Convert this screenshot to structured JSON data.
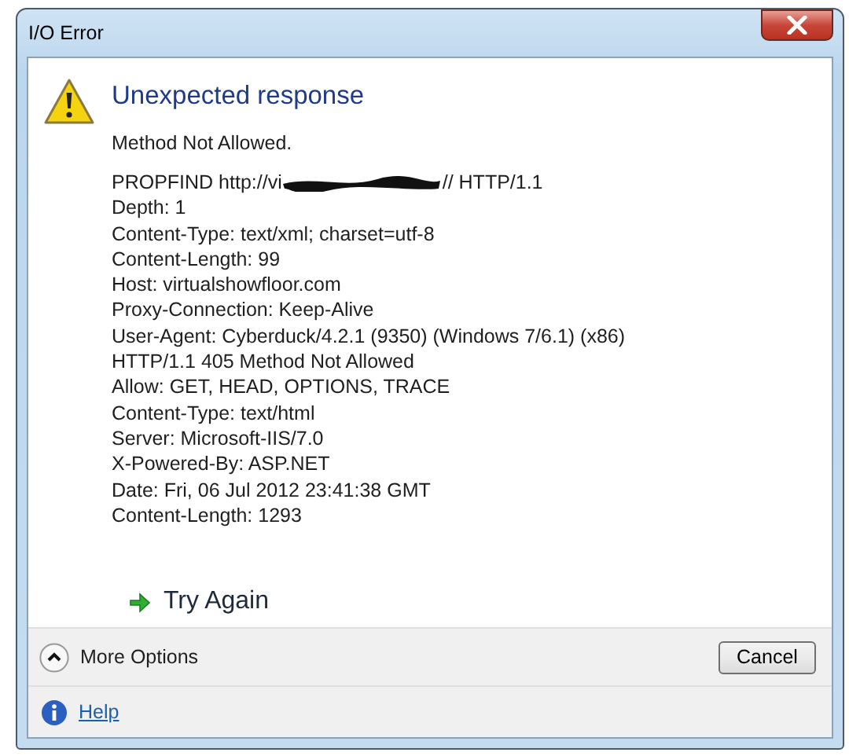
{
  "window": {
    "title": "I/O Error"
  },
  "heading": "Unexpected response",
  "summary": "Method Not Allowed.",
  "request_line": {
    "before": "PROPFIND http://vi",
    "after": "// HTTP/1.1"
  },
  "details": [
    "Depth: 1",
    "Content-Type: text/xml; charset=utf-8",
    "Content-Length: 99",
    "Host: virtualshowfloor.com",
    "Proxy-Connection: Keep-Alive",
    "User-Agent: Cyberduck/4.2.1 (9350) (Windows 7/6.1) (x86)",
    "HTTP/1.1 405 Method Not Allowed",
    "Allow: GET, HEAD, OPTIONS, TRACE",
    "Content-Type: text/html",
    "Server: Microsoft-IIS/7.0",
    "X-Powered-By: ASP.NET",
    "Date: Fri, 06 Jul 2012 23:41:38 GMT",
    "Content-Length: 1293"
  ],
  "command_link": "Try Again",
  "more_options": {
    "label": "More Options",
    "expanded": true
  },
  "buttons": [
    "Cancel"
  ],
  "help_link": "Help"
}
